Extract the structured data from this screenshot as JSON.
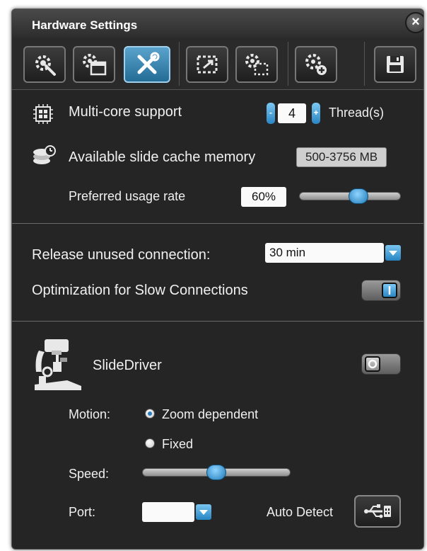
{
  "window": {
    "title": "Hardware Settings",
    "close_glyph": "×"
  },
  "toolbar": {
    "buttons": [
      {
        "icon": "gear-wrench-icon",
        "active": false
      },
      {
        "icon": "gear-window-icon",
        "active": false
      },
      {
        "icon": "tools-icon",
        "active": true
      },
      {
        "icon": "region-select-icon",
        "active": false
      },
      {
        "icon": "gear-region-icon",
        "active": false
      },
      {
        "icon": "gear-plus-icon",
        "active": false
      },
      {
        "icon": "save-icon",
        "active": false
      }
    ]
  },
  "performance": {
    "multicore_label": "Multi-core support",
    "threads_value": "4",
    "threads_unit": "Thread(s)",
    "stepper_minus": "-",
    "stepper_plus": "+",
    "cache_label": "Available slide cache memory",
    "cache_range": "500-3756 MB",
    "usage_label": "Preferred usage rate",
    "usage_value": "60%",
    "usage_fraction": 0.6
  },
  "connection": {
    "release_label": "Release unused connection:",
    "release_value": "30 min",
    "optimization_label": "Optimization for Slow Connections",
    "optimization_on": true
  },
  "slidedriver": {
    "name": "SlideDriver",
    "enabled": false,
    "motion_label": "Motion:",
    "motion_options": [
      "Zoom dependent",
      "Fixed"
    ],
    "motion_selected": "Zoom dependent",
    "speed_label": "Speed:",
    "speed_fraction": 0.5,
    "port_label": "Port:",
    "port_value": "",
    "auto_detect_label": "Auto Detect"
  },
  "colors": {
    "panel_bg": "#252525",
    "accent_blue": "#2a86c4",
    "divider": "#6a6a6a"
  }
}
